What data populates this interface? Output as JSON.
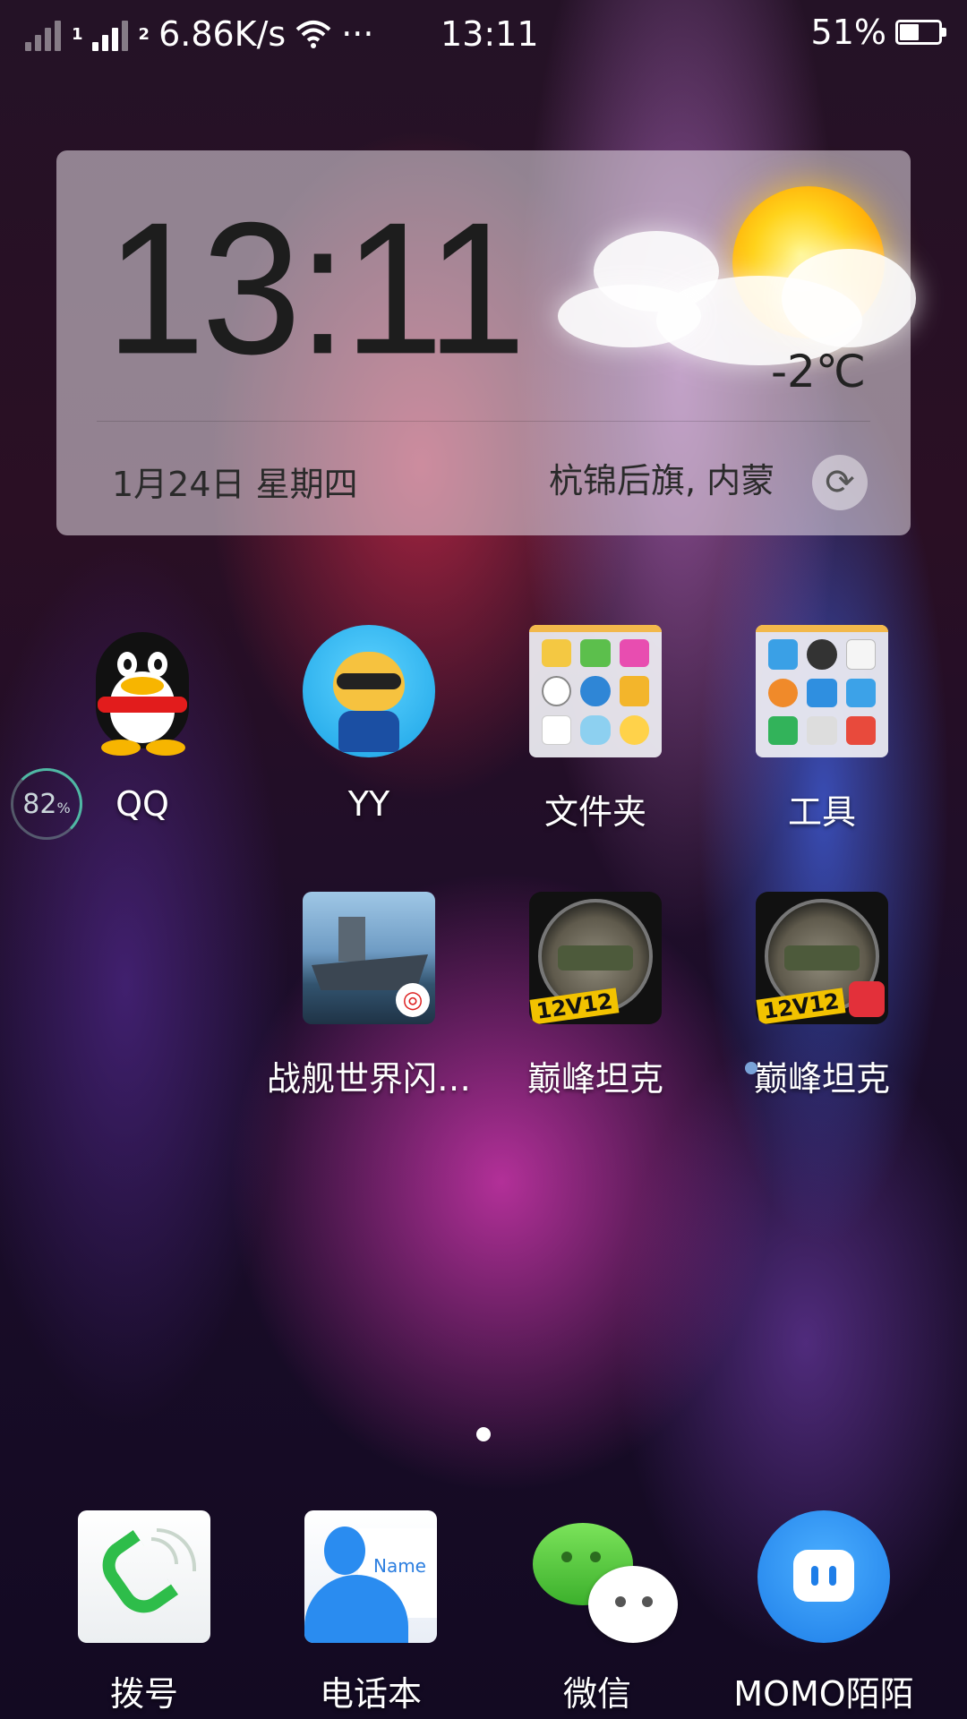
{
  "status_bar": {
    "sim1": "1",
    "sim2": "2",
    "network_speed": "6.86K/s",
    "more": "···",
    "time": "13:11",
    "battery_percent": "51%",
    "battery_level": 0.51
  },
  "weather_widget": {
    "time": "13:11",
    "temperature": "-2℃",
    "date": "1月24日 星期四",
    "location": "杭锦后旗, 内蒙"
  },
  "memory_indicator": {
    "value": "82",
    "unit": "%"
  },
  "apps": {
    "qq": "QQ",
    "yy": "YY",
    "folder": "文件夹",
    "tools": "工具",
    "warships": "战舰世界闪…",
    "tank1": "巅峰坦克",
    "tank2": "巅峰坦克"
  },
  "tank_badge": "12V12",
  "contacts_card_label": "Name",
  "dock": {
    "dialer": "拨号",
    "contacts": "电话本",
    "wechat": "微信",
    "momo": "MOMO陌陌"
  },
  "icons": {
    "status": [
      "no-sim-signal-icon",
      "signal-icon",
      "wifi-icon",
      "battery-icon"
    ],
    "widget": [
      "sun-cloud-icon",
      "refresh-icon"
    ]
  },
  "colors": {
    "weather_sun": "#ffb300",
    "dialer_green": "#2ebd4a",
    "contacts_blue": "#2a8cf0",
    "wechat_green": "#44b535",
    "momo_blue": "#1e7ee8"
  }
}
